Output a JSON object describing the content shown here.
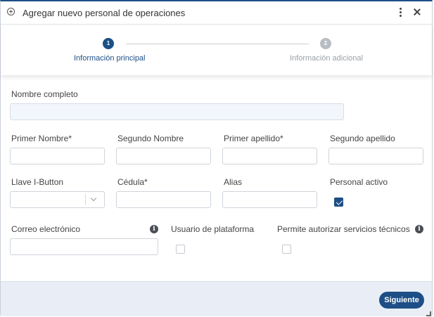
{
  "dialog": {
    "title": "Agregar nuevo personal de operaciones",
    "title_icon": "plus-circle-icon",
    "menu_icon": "kebab-menu-icon",
    "close_icon": "close-icon"
  },
  "stepper": {
    "steps": [
      {
        "number": "1",
        "label": "Información principal",
        "active": true
      },
      {
        "number": "2",
        "label": "Información adicional",
        "active": false
      }
    ]
  },
  "form": {
    "nombre_completo": {
      "label": "Nombre completo",
      "value": ""
    },
    "primer_nombre": {
      "label": "Primer Nombre*",
      "value": ""
    },
    "segundo_nombre": {
      "label": "Segundo Nombre",
      "value": ""
    },
    "primer_apellido": {
      "label": "Primer apellido*",
      "value": ""
    },
    "segundo_apellido": {
      "label": "Segundo apellido",
      "value": ""
    },
    "llave_ibutton": {
      "label": "Llave I-Button",
      "value": ""
    },
    "cedula": {
      "label": "Cédula*",
      "value": ""
    },
    "alias": {
      "label": "Alias",
      "value": ""
    },
    "personal_activo": {
      "label": "Personal activo",
      "checked": true
    },
    "correo": {
      "label": "Correo electrónico",
      "value": ""
    },
    "usuario_plataforma": {
      "label": "Usuario de plataforma",
      "checked": false
    },
    "permite_autorizar": {
      "label": "Permite autorizar servicios técnicos",
      "checked": false
    }
  },
  "footer": {
    "next_label": "Siguiente"
  },
  "colors": {
    "accent": "#1d4f86",
    "inactive_step": "#b8bdc3",
    "footer_bg": "#e9eef6"
  }
}
